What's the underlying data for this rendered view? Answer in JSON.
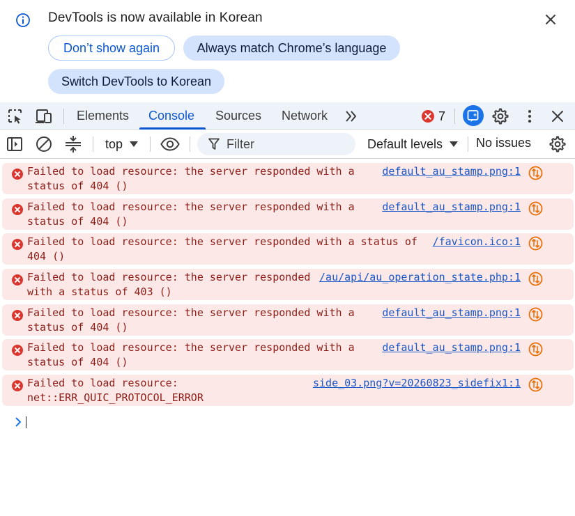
{
  "infobar": {
    "title": "DevTools is now available in Korean",
    "buttons": {
      "dont_show": "Don’t show again",
      "match_language": "Always match Chrome’s language",
      "switch_korean": "Switch DevTools to Korean"
    },
    "icons": {
      "info": "info-icon",
      "close": "close-icon"
    }
  },
  "tabbar": {
    "tabs": [
      "Elements",
      "Console",
      "Sources",
      "Network"
    ],
    "active_tab": "Console",
    "error_count": "7",
    "icons": [
      "inspect-element-icon",
      "device-toolbar-icon",
      "more-tabs-icon",
      "error-icon",
      "ai-assistance-icon",
      "settings-icon",
      "more-options-icon",
      "close-devtools-icon"
    ]
  },
  "console_toolbar": {
    "context": "top",
    "filter_placeholder": "Filter",
    "levels": "Default levels",
    "issues": "No issues",
    "icons": [
      "sidebar-toggle-icon",
      "clear-console-icon",
      "group-similar-icon",
      "live-expression-eye-icon",
      "filter-icon",
      "console-settings-icon"
    ]
  },
  "messages": [
    {
      "line1": "Failed to load resource: the server responded with a",
      "line2": "status of 404 ()",
      "source": "default_au_stamp.png:1"
    },
    {
      "line1": "Failed to load resource: the server responded with a",
      "line2": "status of 404 ()",
      "source": "default_au_stamp.png:1"
    },
    {
      "line1": "Failed to load resource: the server responded with a status of",
      "line2": "404 ()",
      "source": "/favicon.ico:1"
    },
    {
      "line1": "Failed to load resource: the server responded",
      "line2": "with a status of 403 ()",
      "source": "/au/api/au_operation_state.php:1"
    },
    {
      "line1": "Failed to load resource: the server responded with a",
      "line2": "status of 404 ()",
      "source": "default_au_stamp.png:1"
    },
    {
      "line1": "Failed to load resource: the server responded with a",
      "line2": "status of 404 ()",
      "source": "default_au_stamp.png:1"
    },
    {
      "line1": "Failed to load resource:",
      "line2": "net::ERR_QUIC_PROTOCOL_ERROR",
      "source": "side_03.png?v=20260823_sidefix1:1"
    }
  ],
  "colors": {
    "accent": "#0b57d0",
    "error_bg": "#fce8e6",
    "error_text": "#8c1d18",
    "error_icon": "#dc362e",
    "network_icon": "#e8710a",
    "link": "#1a57c7"
  }
}
